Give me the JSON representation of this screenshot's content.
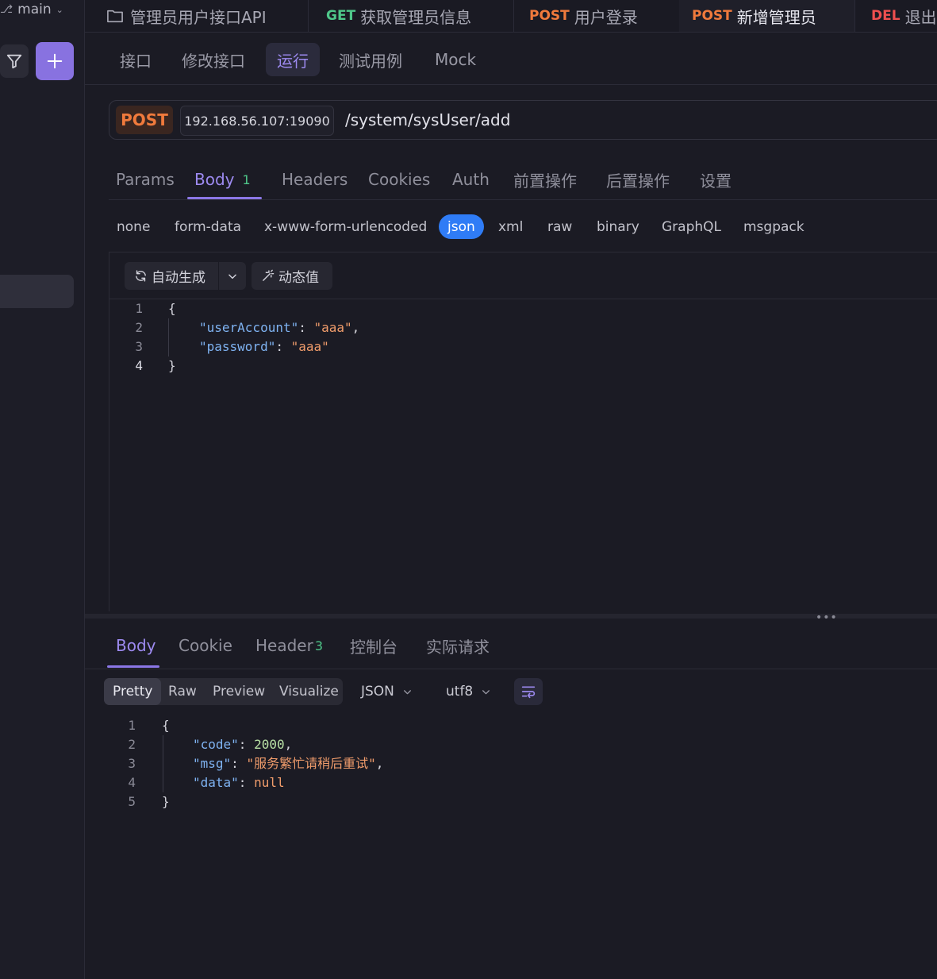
{
  "sidebar": {
    "branch": "main"
  },
  "tabs": [
    {
      "method": "",
      "label": "管理员用户接口API",
      "icon": "folder-icon"
    },
    {
      "method": "GET",
      "label": "获取管理员信息"
    },
    {
      "method": "POST",
      "label": "用户登录"
    },
    {
      "method": "POST",
      "label": "新增管理员"
    },
    {
      "method": "DEL",
      "label": "退出登录"
    }
  ],
  "subnav": [
    "接口",
    "修改接口",
    "运行",
    "测试用例",
    "Mock"
  ],
  "request": {
    "method": "POST",
    "host": "192.168.56.107:19090",
    "path": "/system/sysUser/add"
  },
  "request_tabs": [
    "Params",
    "Body",
    "Headers",
    "Cookies",
    "Auth",
    "前置操作",
    "后置操作",
    "设置"
  ],
  "body_count": "1",
  "body_types": [
    "none",
    "form-data",
    "x-www-form-urlencoded",
    "json",
    "xml",
    "raw",
    "binary",
    "GraphQL",
    "msgpack"
  ],
  "editor_toolbar": {
    "auto_generate": "自动生成",
    "dynamic_value": "动态值"
  },
  "request_body": {
    "line_numbers": [
      "1",
      "2",
      "3",
      "4"
    ],
    "brace_open": "{",
    "brace_close": "}",
    "key1": "\"userAccount\"",
    "val1": "\"aaa\"",
    "key2": "\"password\"",
    "val2": "\"aaa\""
  },
  "response_tabs": [
    "Body",
    "Cookie",
    "Header",
    "控制台",
    "实际请求"
  ],
  "header_count": "3",
  "response_views": [
    "Pretty",
    "Raw",
    "Preview",
    "Visualize"
  ],
  "response_format": "JSON",
  "response_encoding": "utf8",
  "response_body": {
    "line_numbers": [
      "1",
      "2",
      "3",
      "4",
      "5"
    ],
    "brace_open": "{",
    "brace_close": "}",
    "key1": "\"code\"",
    "val1": "2000",
    "key2": "\"msg\"",
    "val2": "\"服务繁忙请稍后重试\"",
    "key3": "\"data\"",
    "val3": "null"
  },
  "colors": {
    "accent": "#8b77e6",
    "post": "#f07a3c",
    "get": "#4fc78a",
    "delete": "#ef4f4f",
    "json_chip": "#2f7cf6"
  }
}
